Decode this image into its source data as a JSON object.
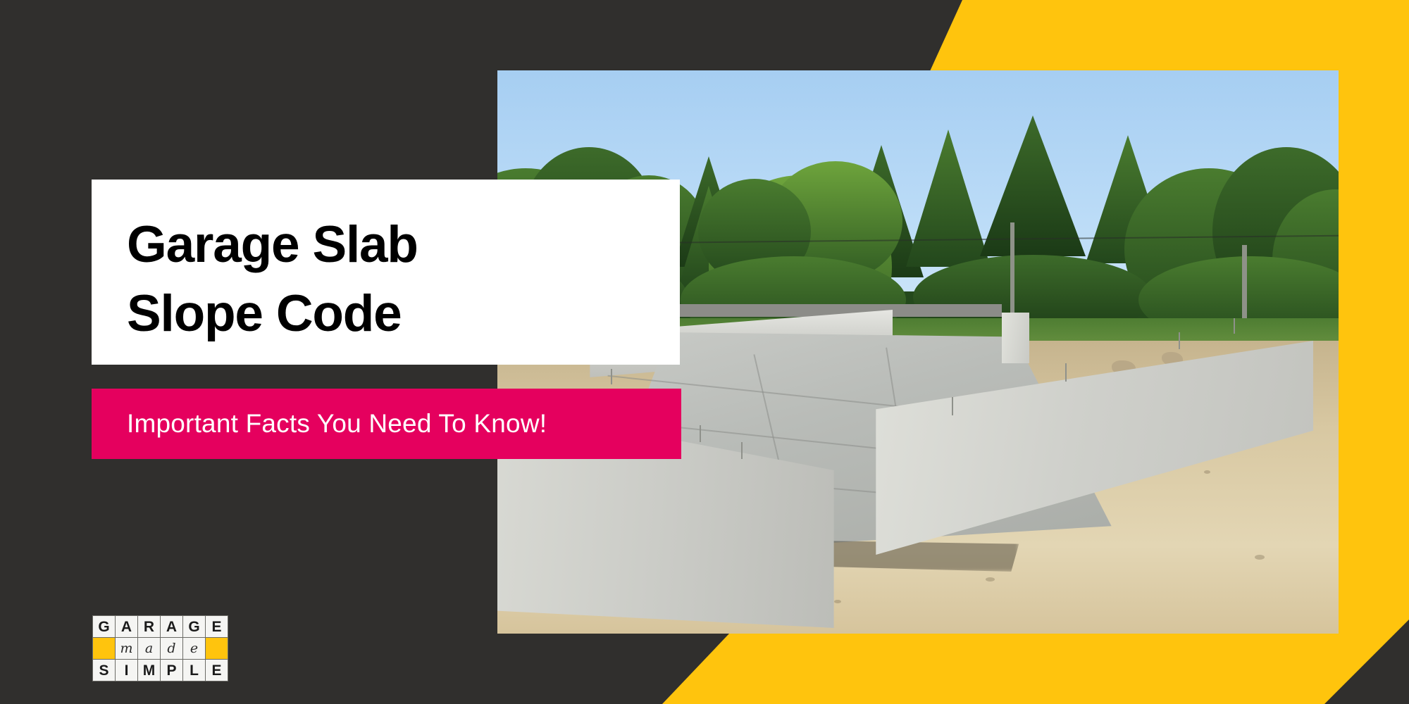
{
  "theme": {
    "background": "#302F2D",
    "accent_yellow": "#FFC40D",
    "accent_pink": "#E5005E",
    "card_white": "#FFFFFF",
    "title_black": "#000000"
  },
  "title_card": {
    "line1": "Garage Slab",
    "line2": "Slope Code"
  },
  "subtitle": {
    "text": "Important Facts You Need To Know!"
  },
  "logo": {
    "row1": [
      "G",
      "A",
      "R",
      "A",
      "G",
      "E"
    ],
    "row2": [
      "",
      "m",
      "a",
      "d",
      "e",
      ""
    ],
    "row3": [
      "S",
      "I",
      "M",
      "P",
      "L",
      "E"
    ],
    "alt": "Garage Made Simple"
  },
  "photo": {
    "alt": "Poured concrete garage foundation slab with perimeter stem walls, anchor bolts and sandy backfill, surrounded by green trees under a blue sky"
  }
}
